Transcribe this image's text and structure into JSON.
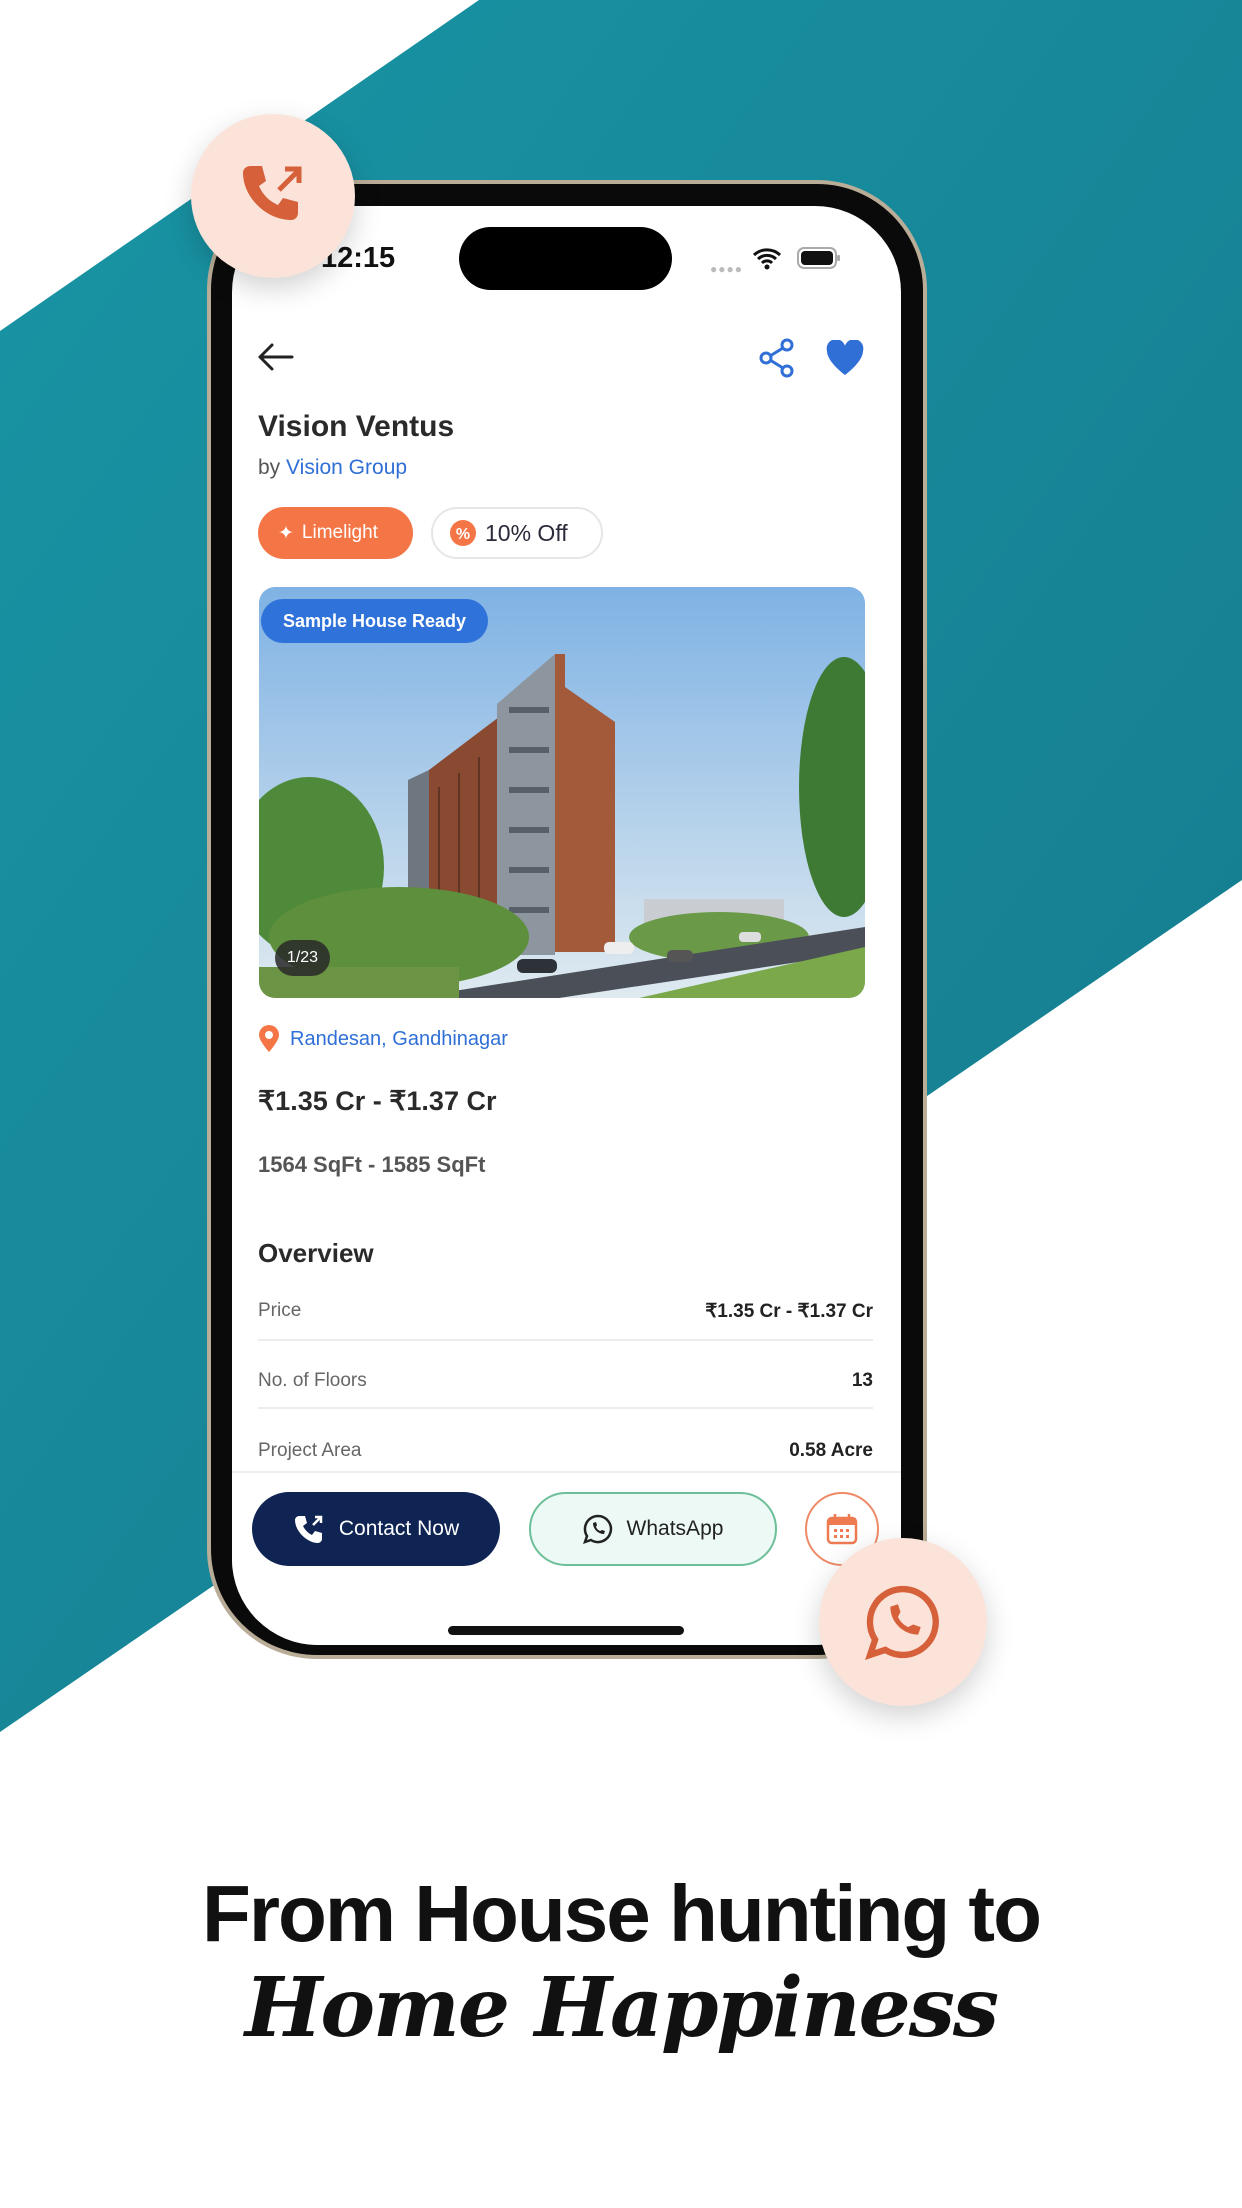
{
  "colors": {
    "teal": "#17889b",
    "accent_orange": "#f47646",
    "link_blue": "#2f6fd6",
    "navy": "#0f2453",
    "bubble": "#fce3da"
  },
  "status_bar": {
    "time": "12:15"
  },
  "property": {
    "title": "Vision Ventus",
    "by_label": "by",
    "builder": "Vision Group",
    "badges": {
      "limelight": "Limelight",
      "discount": "10% Off"
    },
    "photo": {
      "tag": "Sample House Ready",
      "counter": "1/23"
    },
    "location": "Randesan, Gandhinagar",
    "price": "₹1.35 Cr - ₹1.37 Cr",
    "area": "1564 SqFt - 1585 SqFt"
  },
  "overview": {
    "heading": "Overview",
    "rows": [
      {
        "label": "Price",
        "value": "₹1.35 Cr - ₹1.37 Cr"
      },
      {
        "label": "No. of Floors",
        "value": "13"
      },
      {
        "label": "Project Area",
        "value": "0.58 Acre"
      }
    ]
  },
  "actions": {
    "contact": "Contact Now",
    "whatsapp": "WhatsApp"
  },
  "headline": {
    "line1": "From House hunting to",
    "line2": "Home Happiness"
  }
}
